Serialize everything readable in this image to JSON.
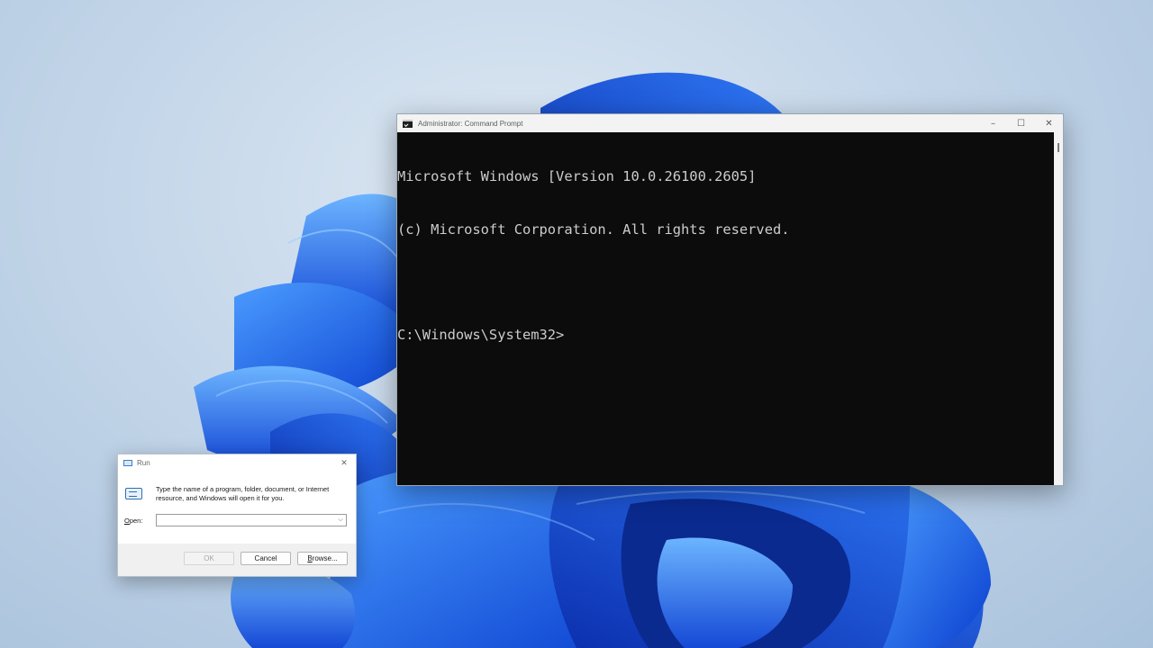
{
  "cmd": {
    "title": "Administrator: Command Prompt",
    "lines": [
      "Microsoft Windows [Version 10.0.26100.2605]",
      "(c) Microsoft Corporation. All rights reserved.",
      "",
      "C:\\Windows\\System32>"
    ],
    "controls": {
      "minimize": "–",
      "maximize": "☐",
      "close": "✕"
    },
    "icon": "cmd-icon",
    "background": "#0c0c0c",
    "text_color": "#cccccc"
  },
  "run": {
    "title": "Run",
    "close": "✕",
    "description": "Type the name of a program, folder, document, or Internet resource, and Windows will open it for you.",
    "open_label_accel": "O",
    "open_label_rest": "pen:",
    "input_value": "",
    "dropdown_glyph": "⌵",
    "ok_label": "OK",
    "cancel_label": "Cancel",
    "browse_accel": "B",
    "browse_rest": "rowse...",
    "icon": "run-icon"
  },
  "desktop": {
    "wallpaper": "windows-11-bloom",
    "accent": "#1a5fe0"
  }
}
